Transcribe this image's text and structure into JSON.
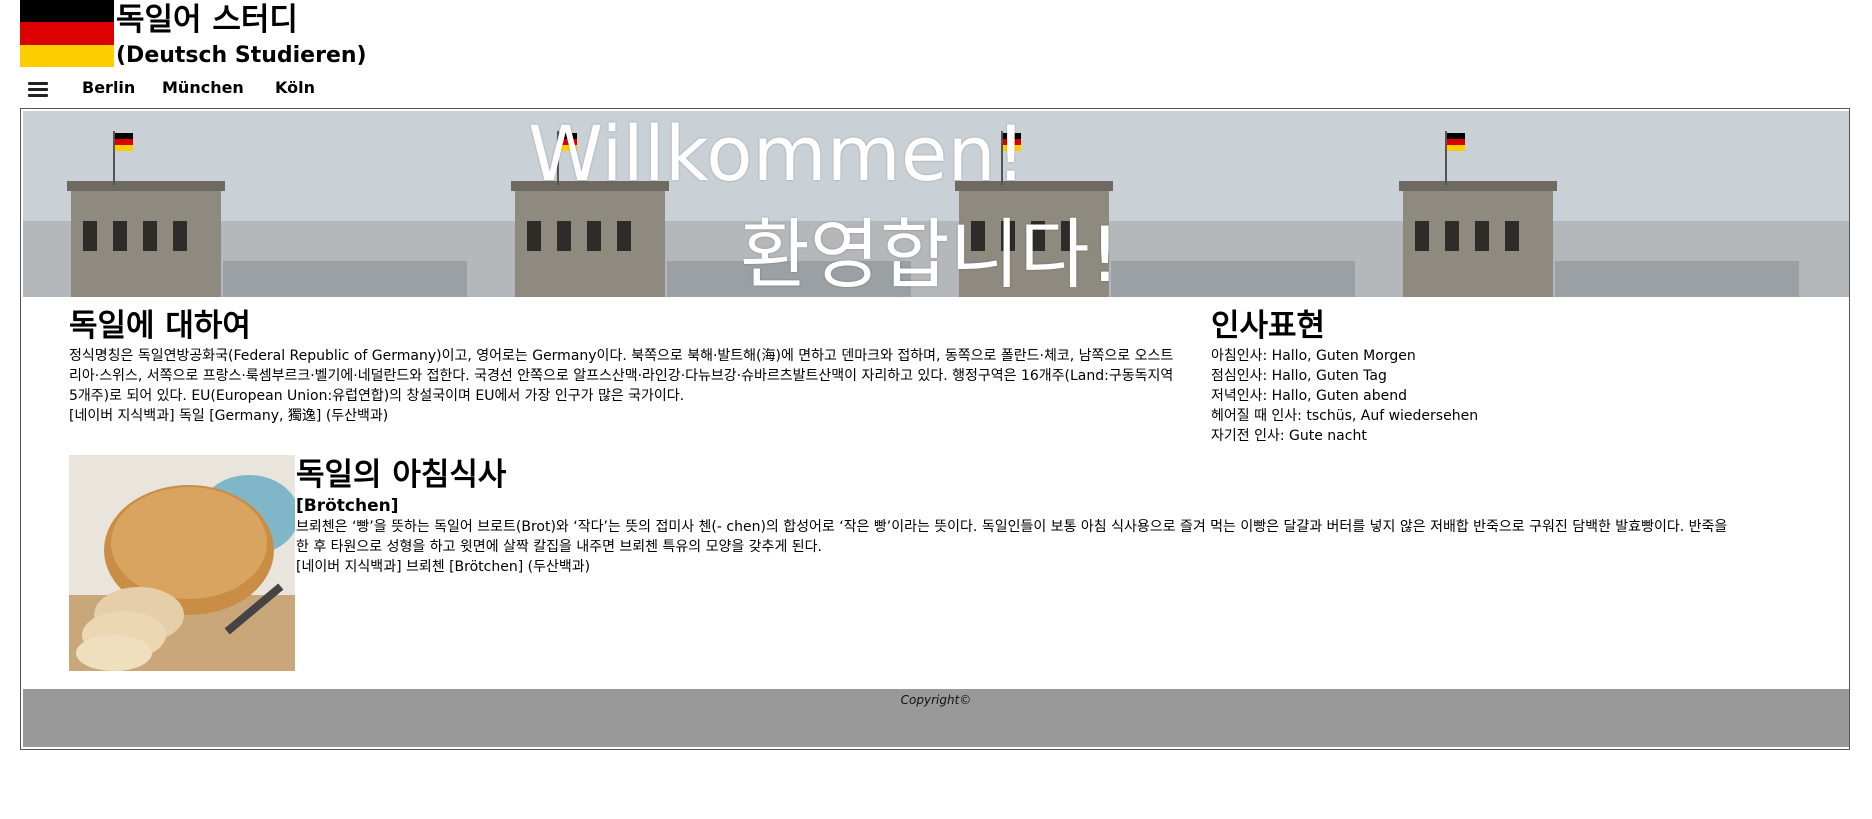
{
  "header": {
    "title": "독일어 스터디",
    "subtitle": "(Deutsch Studieren)",
    "flag_colors": [
      "#000000",
      "#DD0000",
      "#FFCE00"
    ]
  },
  "nav": {
    "menu_icon": "hamburger-menu-icon",
    "items": [
      "Berlin",
      "München",
      "Köln"
    ]
  },
  "banner": {
    "welcome": "Willkommen!",
    "welcome_ko": "환영합니다!"
  },
  "about": {
    "heading": "독일에 대하여",
    "text": "정식명칭은 독일연방공화국(Federal Republic of Germany)이고, 영어로는 Germany이다. 북쪽으로 북해·발트해(海)에 면하고 덴마크와 접하며, 동쪽으로 폴란드·체코, 남쪽으로 오스트리아·스위스, 서쪽으로 프랑스·룩셈부르크·벨기에·네덜란드와 접한다. 국경선 안쪽으로 알프스산맥·라인강·다뉴브강·슈바르츠발트산맥이 자리하고 있다. 행정구역은 16개주(Land:구동독지역 5개주)로 되어 있다. EU(European Union:유럽연합)의 창설국이며 EU에서 가장 인구가 많은 국가이다.",
    "source": "[네이버 지식백과] 독일 [Germany, 獨逸] (두산백과)"
  },
  "greetings": {
    "heading": "인사표현",
    "items": [
      "아침인사: Hallo, Guten Morgen",
      "점심인사: Hallo, Guten Tag",
      "저녁인사: Hallo, Guten abend",
      "헤어질 때 인사: tschüs, Auf wiedersehen",
      "자기전 인사: Gute nacht"
    ]
  },
  "breakfast": {
    "heading": "독일의 아침식사",
    "subheading": "[Brötchen]",
    "text": "브뢰첸은 ‘빵’을 뜻하는 독일어 브로트(Brot)와 ‘작다’는 뜻의 접미사 첸(- chen)의 합성어로 ‘작은 빵’이라는 뜻이다. 독일인들이 보통 아침 식사용으로 즐겨 먹는 이빵은 달걀과 버터를 넣지 않은 저배합 반죽으로 구워진 담백한 발효빵이다. 반죽을 한 후 타원으로 성형을 하고 윗면에 살짝 칼집을 내주면 브뢰첸 특유의 모양을 갖추게 된다.",
    "source": "[네이버 지식백과] 브뢰첸 [Brötchen] (두산백과)"
  },
  "footer": {
    "copyright": "Copyright©",
    "background": "#999999"
  }
}
